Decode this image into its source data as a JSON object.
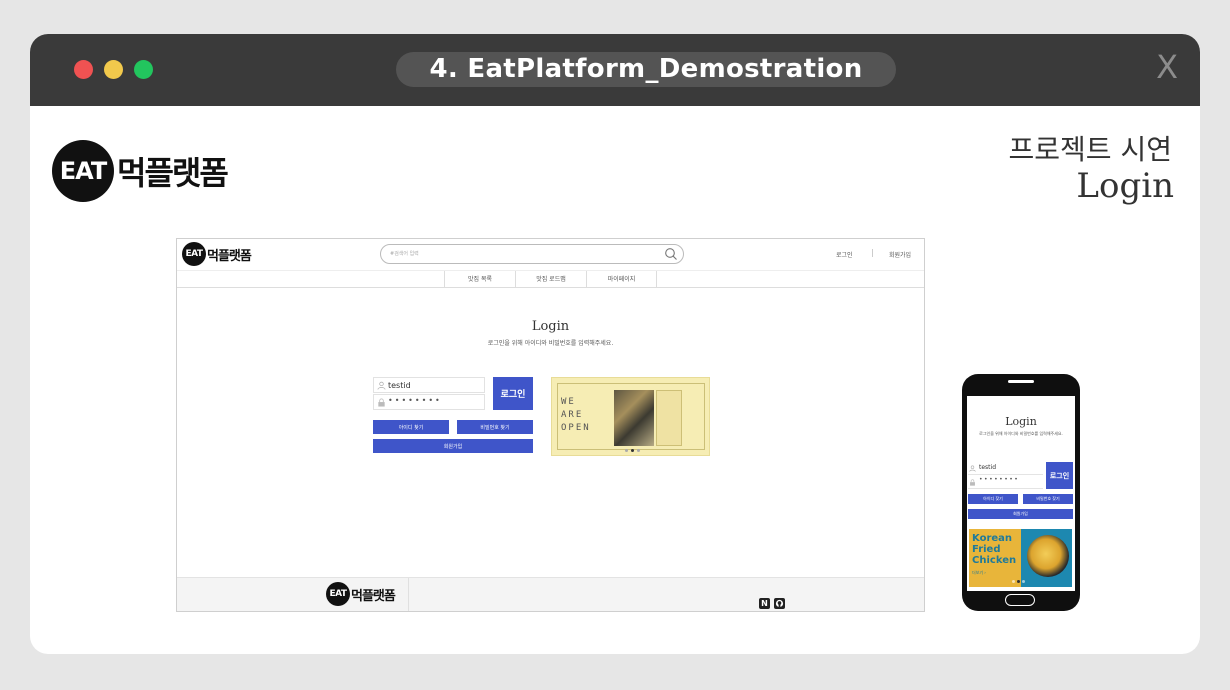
{
  "window": {
    "title": "4. EatPlatform_Demostration",
    "close_label": "X"
  },
  "brand": {
    "badge": "EAT",
    "name": "먹플랫폼"
  },
  "demo": {
    "subtitle": "프로젝트 시연",
    "title": "Login"
  },
  "desktop": {
    "search_placeholder": "#검색어 입력",
    "nav_login": "로그인",
    "nav_signup": "회원가입",
    "menu": [
      "맛집 목록",
      "맛집 로드맵",
      "마이페이지"
    ],
    "login_title": "Login",
    "login_subtitle": "로그인을 위해 아이디와 비밀번호를 입력해주세요.",
    "id_value": "testid",
    "password_mask": "••••••••",
    "login_button": "로그인",
    "find_id_button": "아이디 찾기",
    "find_pw_button": "비밀번호 찾기",
    "signup_button": "회원가입",
    "banner_text": "WE\nARE\nOPEN",
    "footer_icons": [
      "notion-icon",
      "github-icon"
    ]
  },
  "mobile": {
    "login_title": "Login",
    "login_subtitle": "로그인을 위해 아이디와 비밀번호를 입력해주세요.",
    "id_value": "testid",
    "password_mask": "••••••••",
    "login_button": "로그인",
    "find_id_button": "아이디 찾기",
    "find_pw_button": "비밀번호 찾기",
    "signup_button": "회원가입",
    "banner_text": "Korean\nFried\nChicken",
    "banner_small": "더보기 ›"
  },
  "colors": {
    "titlebar": "#3a3a3a",
    "accent": "#3f55c9",
    "traffic_red": "#f05252",
    "traffic_yellow": "#f2c94c",
    "traffic_green": "#22c55e"
  }
}
